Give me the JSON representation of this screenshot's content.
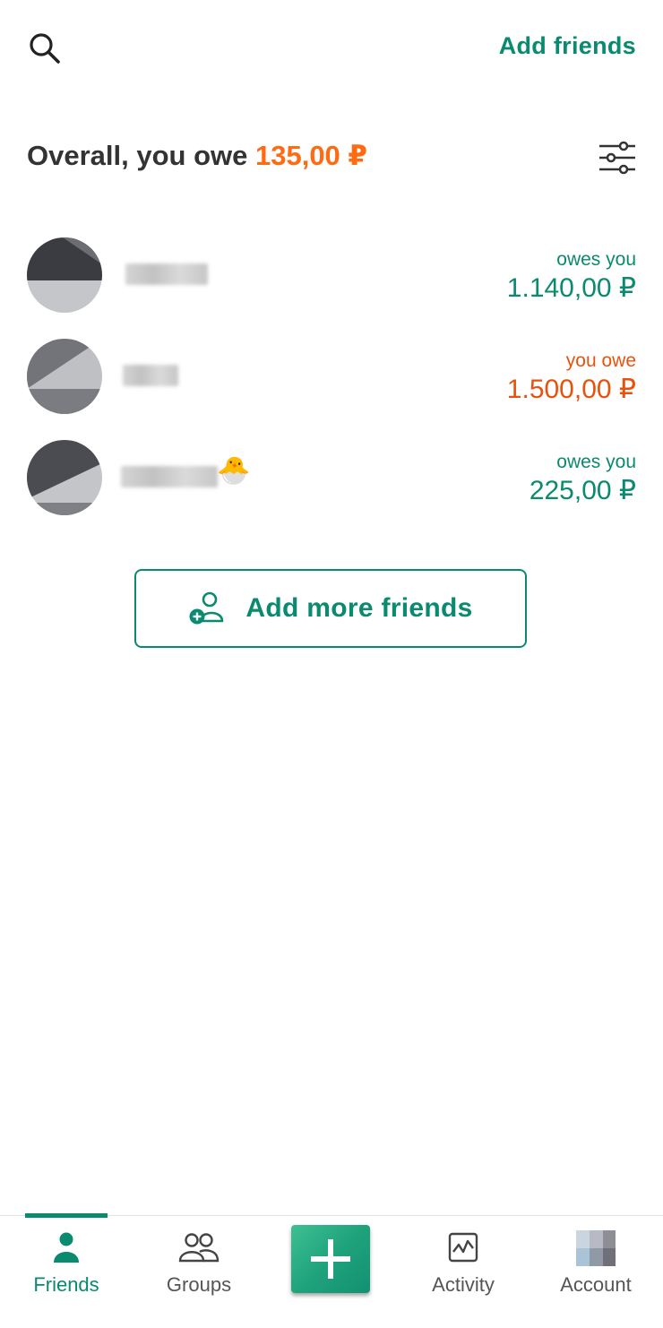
{
  "header": {
    "add_friends_label": "Add friends"
  },
  "summary": {
    "prefix": "Overall, you owe ",
    "amount": "135,00 ₽"
  },
  "friends": [
    {
      "status": "owes you",
      "amount": "1.140,00 ₽",
      "tone": "green"
    },
    {
      "status": "you owe",
      "amount": "1.500,00 ₽",
      "tone": "orange"
    },
    {
      "status": "owes you",
      "amount": "225,00 ₽",
      "tone": "green",
      "emoji": "🐣"
    }
  ],
  "add_more_label": "Add more friends",
  "nav": {
    "friends": "Friends",
    "groups": "Groups",
    "activity": "Activity",
    "account": "Account"
  },
  "colors": {
    "accent": "#0a8a6e",
    "owe": "#ff6a13",
    "owe_row": "#e8520c"
  }
}
